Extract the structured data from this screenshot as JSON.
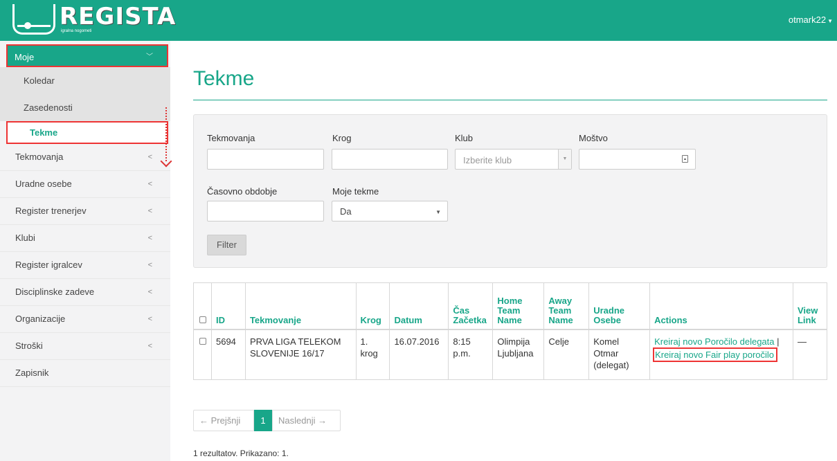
{
  "app": {
    "logo_title": "REGISTA",
    "logo_subtitle": "igralna nogometi",
    "user": "otmark22"
  },
  "sidebar": {
    "moje": "Moje",
    "sub_items": [
      "Koledar",
      "Zasedenosti",
      "Tekme"
    ],
    "items": [
      "Tekmovanja",
      "Uradne osebe",
      "Register trenerjev",
      "Klubi",
      "Register igralcev",
      "Disciplinske zadeve",
      "Organizacije",
      "Stroški",
      "Zapisnik"
    ]
  },
  "page": {
    "title": "Tekme"
  },
  "filters": {
    "tekmovanja_label": "Tekmovanja",
    "krog_label": "Krog",
    "klub_label": "Klub",
    "klub_placeholder": "Izberite klub",
    "mostvo_label": "Moštvo",
    "obdobje_label": "Časovno obdobje",
    "moje_tekme_label": "Moje tekme",
    "moje_tekme_value": "Da",
    "filter_button": "Filter"
  },
  "table": {
    "headers": {
      "id": "ID",
      "tekmovanje": "Tekmovanje",
      "krog": "Krog",
      "datum": "Datum",
      "cas": "Čas Začetka",
      "home": "Home Team Name",
      "away": "Away Team Name",
      "uradne": "Uradne Osebe",
      "actions": "Actions",
      "view": "View Link"
    },
    "rows": [
      {
        "id": "5694",
        "tekmovanje": "PRVA LIGA TELEKOM SLOVENIJE 16/17",
        "krog": "1. krog",
        "datum": "16.07.2016",
        "cas": "8:15 p.m.",
        "home": "Olimpija Ljubljana",
        "away": "Celje",
        "uradne": "Komel Otmar (delegat)",
        "action_delegat": "Kreiraj novo Poročilo delegata",
        "action_separator": "|",
        "action_fairplay": "Kreiraj novo Fair play poročilo",
        "view": "—"
      }
    ]
  },
  "pagination": {
    "prev": "← Prejšnji",
    "current": "1",
    "next": "Naslednji →"
  },
  "summary": "1 rezultatov. Prikazano: 1.",
  "colors": {
    "accent": "#18a689",
    "highlight": "#e33333"
  }
}
